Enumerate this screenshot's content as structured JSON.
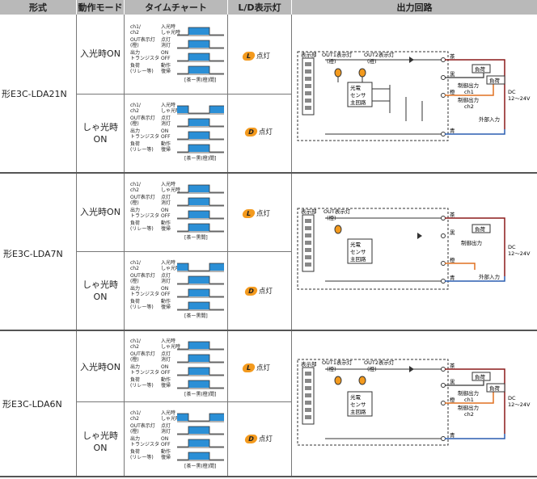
{
  "headers": {
    "form": "形式",
    "mode": "動作モード",
    "timing": "タイムチャート",
    "ld": "L/D表示灯",
    "circuit": "出力回路"
  },
  "models": [
    "形E3C-LDA21N",
    "形E3C-LDA7N",
    "形E3C-LDA6N"
  ],
  "modes": {
    "light_on": "入光時ON",
    "dark_on_l1": "しゃ光時",
    "dark_on_l2": "ON"
  },
  "timing": {
    "labels_2ch": [
      "ch1/",
      "ch2",
      "OUT表示灯",
      "(橙)",
      "出力",
      "トランジスタ",
      "負荷",
      "(リレー等)"
    ],
    "labels_1ch": [
      "ch1/",
      "ch2",
      "OUT表示灯",
      "(橙)",
      "出力",
      "トランジスタ",
      "負荷",
      "(リレー等)"
    ],
    "states": [
      "入光時",
      "しゃ光時",
      "点灯",
      "消灯",
      "ON",
      "OFF",
      "動作",
      "復帰"
    ],
    "period_dual": "[茶ー黒(橙)間]",
    "period_single": "[茶ー黒間]"
  },
  "ld": {
    "L_icon": "L",
    "D_icon": "D",
    "lit": "点灯"
  },
  "circuit": {
    "display": "表示部",
    "out1": "OUT1表示灯",
    "out2": "OUT2表示灯",
    "out": "OUT表示灯",
    "orange": "(橙)",
    "main1": "光電",
    "main2": "センサ",
    "main3": "主回路",
    "brown": "茶",
    "black": "黒",
    "orange_wire": "橙",
    "blue": "青",
    "load": "負荷",
    "ctrl_out": "制御出力",
    "ch1": "ch1",
    "ch2": "ch2",
    "ext_in": "外部入力",
    "dc1": "DC",
    "dc2": "12～24V"
  }
}
